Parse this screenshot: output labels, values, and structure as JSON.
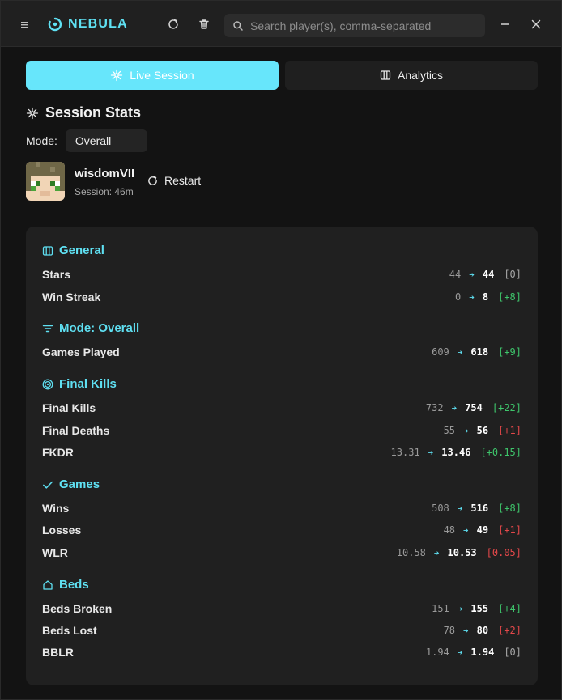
{
  "app": {
    "name": "NEBULA"
  },
  "search": {
    "placeholder": "Search player(s), comma-separated"
  },
  "tabs": {
    "live": "Live Session",
    "analytics": "Analytics"
  },
  "session": {
    "title": "Session Stats",
    "mode_label": "Mode:",
    "mode_value": "Overall",
    "player_name": "wisdomVII",
    "duration": "Session: 46m",
    "restart": "Restart"
  },
  "categories": [
    {
      "title": "General",
      "icon": "columns-icon",
      "stats": [
        {
          "label": "Stars",
          "old": "44",
          "new": "44",
          "delta": "[0]",
          "sign": "zero"
        },
        {
          "label": "Win Streak",
          "old": "0",
          "new": "8",
          "delta": "[+8]",
          "sign": "pos"
        }
      ]
    },
    {
      "title": "Mode: Overall",
      "icon": "filter-icon",
      "stats": [
        {
          "label": "Games Played",
          "old": "609",
          "new": "618",
          "delta": "[+9]",
          "sign": "pos"
        }
      ]
    },
    {
      "title": "Final Kills",
      "icon": "target-icon",
      "stats": [
        {
          "label": "Final Kills",
          "old": "732",
          "new": "754",
          "delta": "[+22]",
          "sign": "pos"
        },
        {
          "label": "Final Deaths",
          "old": "55",
          "new": "56",
          "delta": "[+1]",
          "sign": "neg"
        },
        {
          "label": "FKDR",
          "old": "13.31",
          "new": "13.46",
          "delta": "[+0.15]",
          "sign": "pos"
        }
      ]
    },
    {
      "title": "Games",
      "icon": "check-icon",
      "stats": [
        {
          "label": "Wins",
          "old": "508",
          "new": "516",
          "delta": "[+8]",
          "sign": "pos"
        },
        {
          "label": "Losses",
          "old": "48",
          "new": "49",
          "delta": "[+1]",
          "sign": "neg"
        },
        {
          "label": "WLR",
          "old": "10.58",
          "new": "10.53",
          "delta": "[0.05]",
          "sign": "neg"
        }
      ]
    },
    {
      "title": "Beds",
      "icon": "home-icon",
      "stats": [
        {
          "label": "Beds Broken",
          "old": "151",
          "new": "155",
          "delta": "[+4]",
          "sign": "pos"
        },
        {
          "label": "Beds Lost",
          "old": "78",
          "new": "80",
          "delta": "[+2]",
          "sign": "neg"
        },
        {
          "label": "BBLR",
          "old": "1.94",
          "new": "1.94",
          "delta": "[0]",
          "sign": "zero"
        }
      ]
    }
  ],
  "colors": {
    "accent": "#5fe0f2",
    "tab_active": "#67e6fb",
    "positive": "#3ec56b",
    "negative": "#e4484a"
  }
}
